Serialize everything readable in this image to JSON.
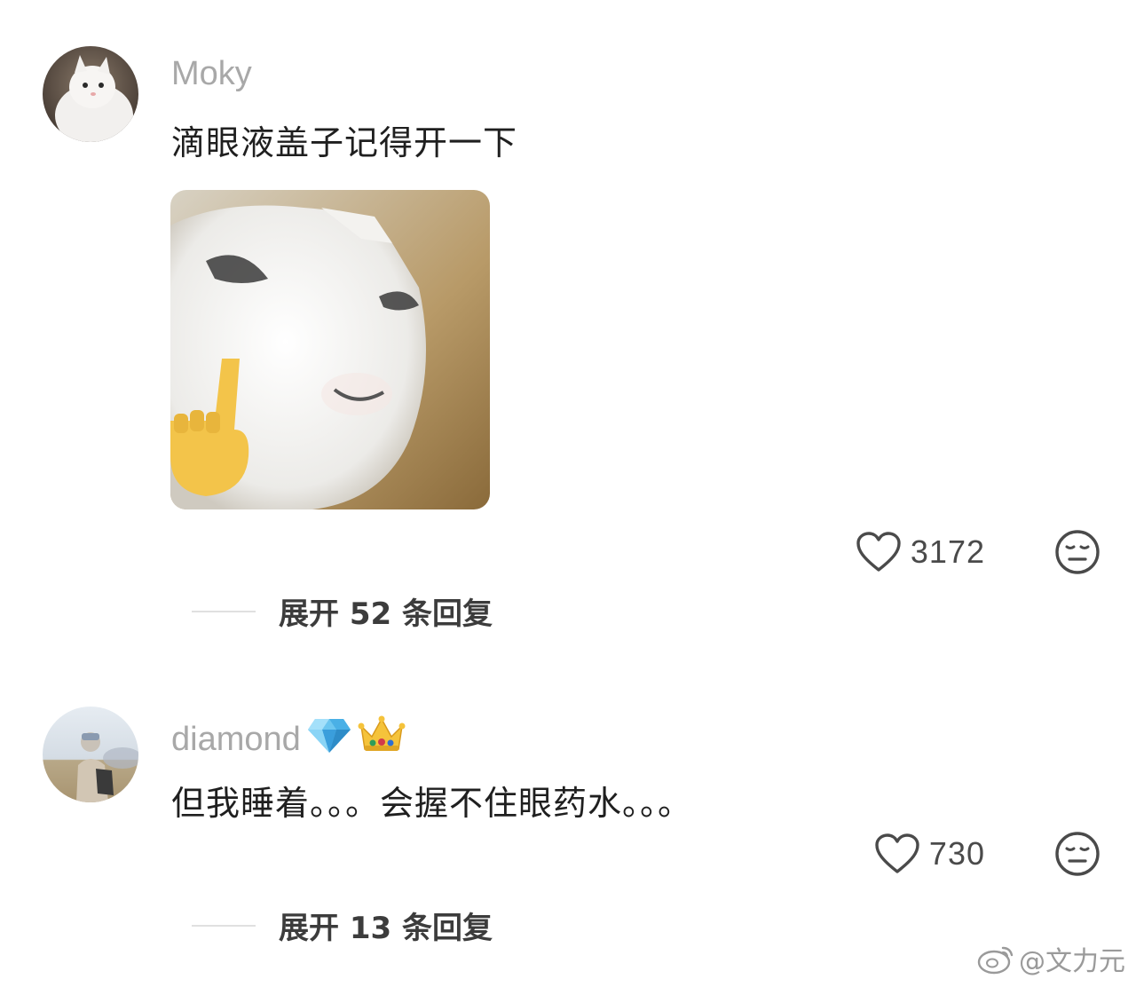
{
  "comments": [
    {
      "username": "Moky",
      "text": "滴眼液盖子记得开一下",
      "likes": "3172",
      "expand": "展开 52 条回复"
    },
    {
      "username": "diamond",
      "badges": [
        "diamond-emoji",
        "crown-emoji"
      ],
      "text": "但我睡着。。。会握不住眼药水。。。",
      "likes": "730",
      "expand": "展开 13 条回复"
    }
  ],
  "watermark": {
    "text": "@文力元",
    "icon": "weibo-icon"
  },
  "colors": {
    "username": "#a8a8a8",
    "text": "#1f1f1f",
    "icon": "#4a4a4a",
    "divider": "#e0e0e0"
  }
}
